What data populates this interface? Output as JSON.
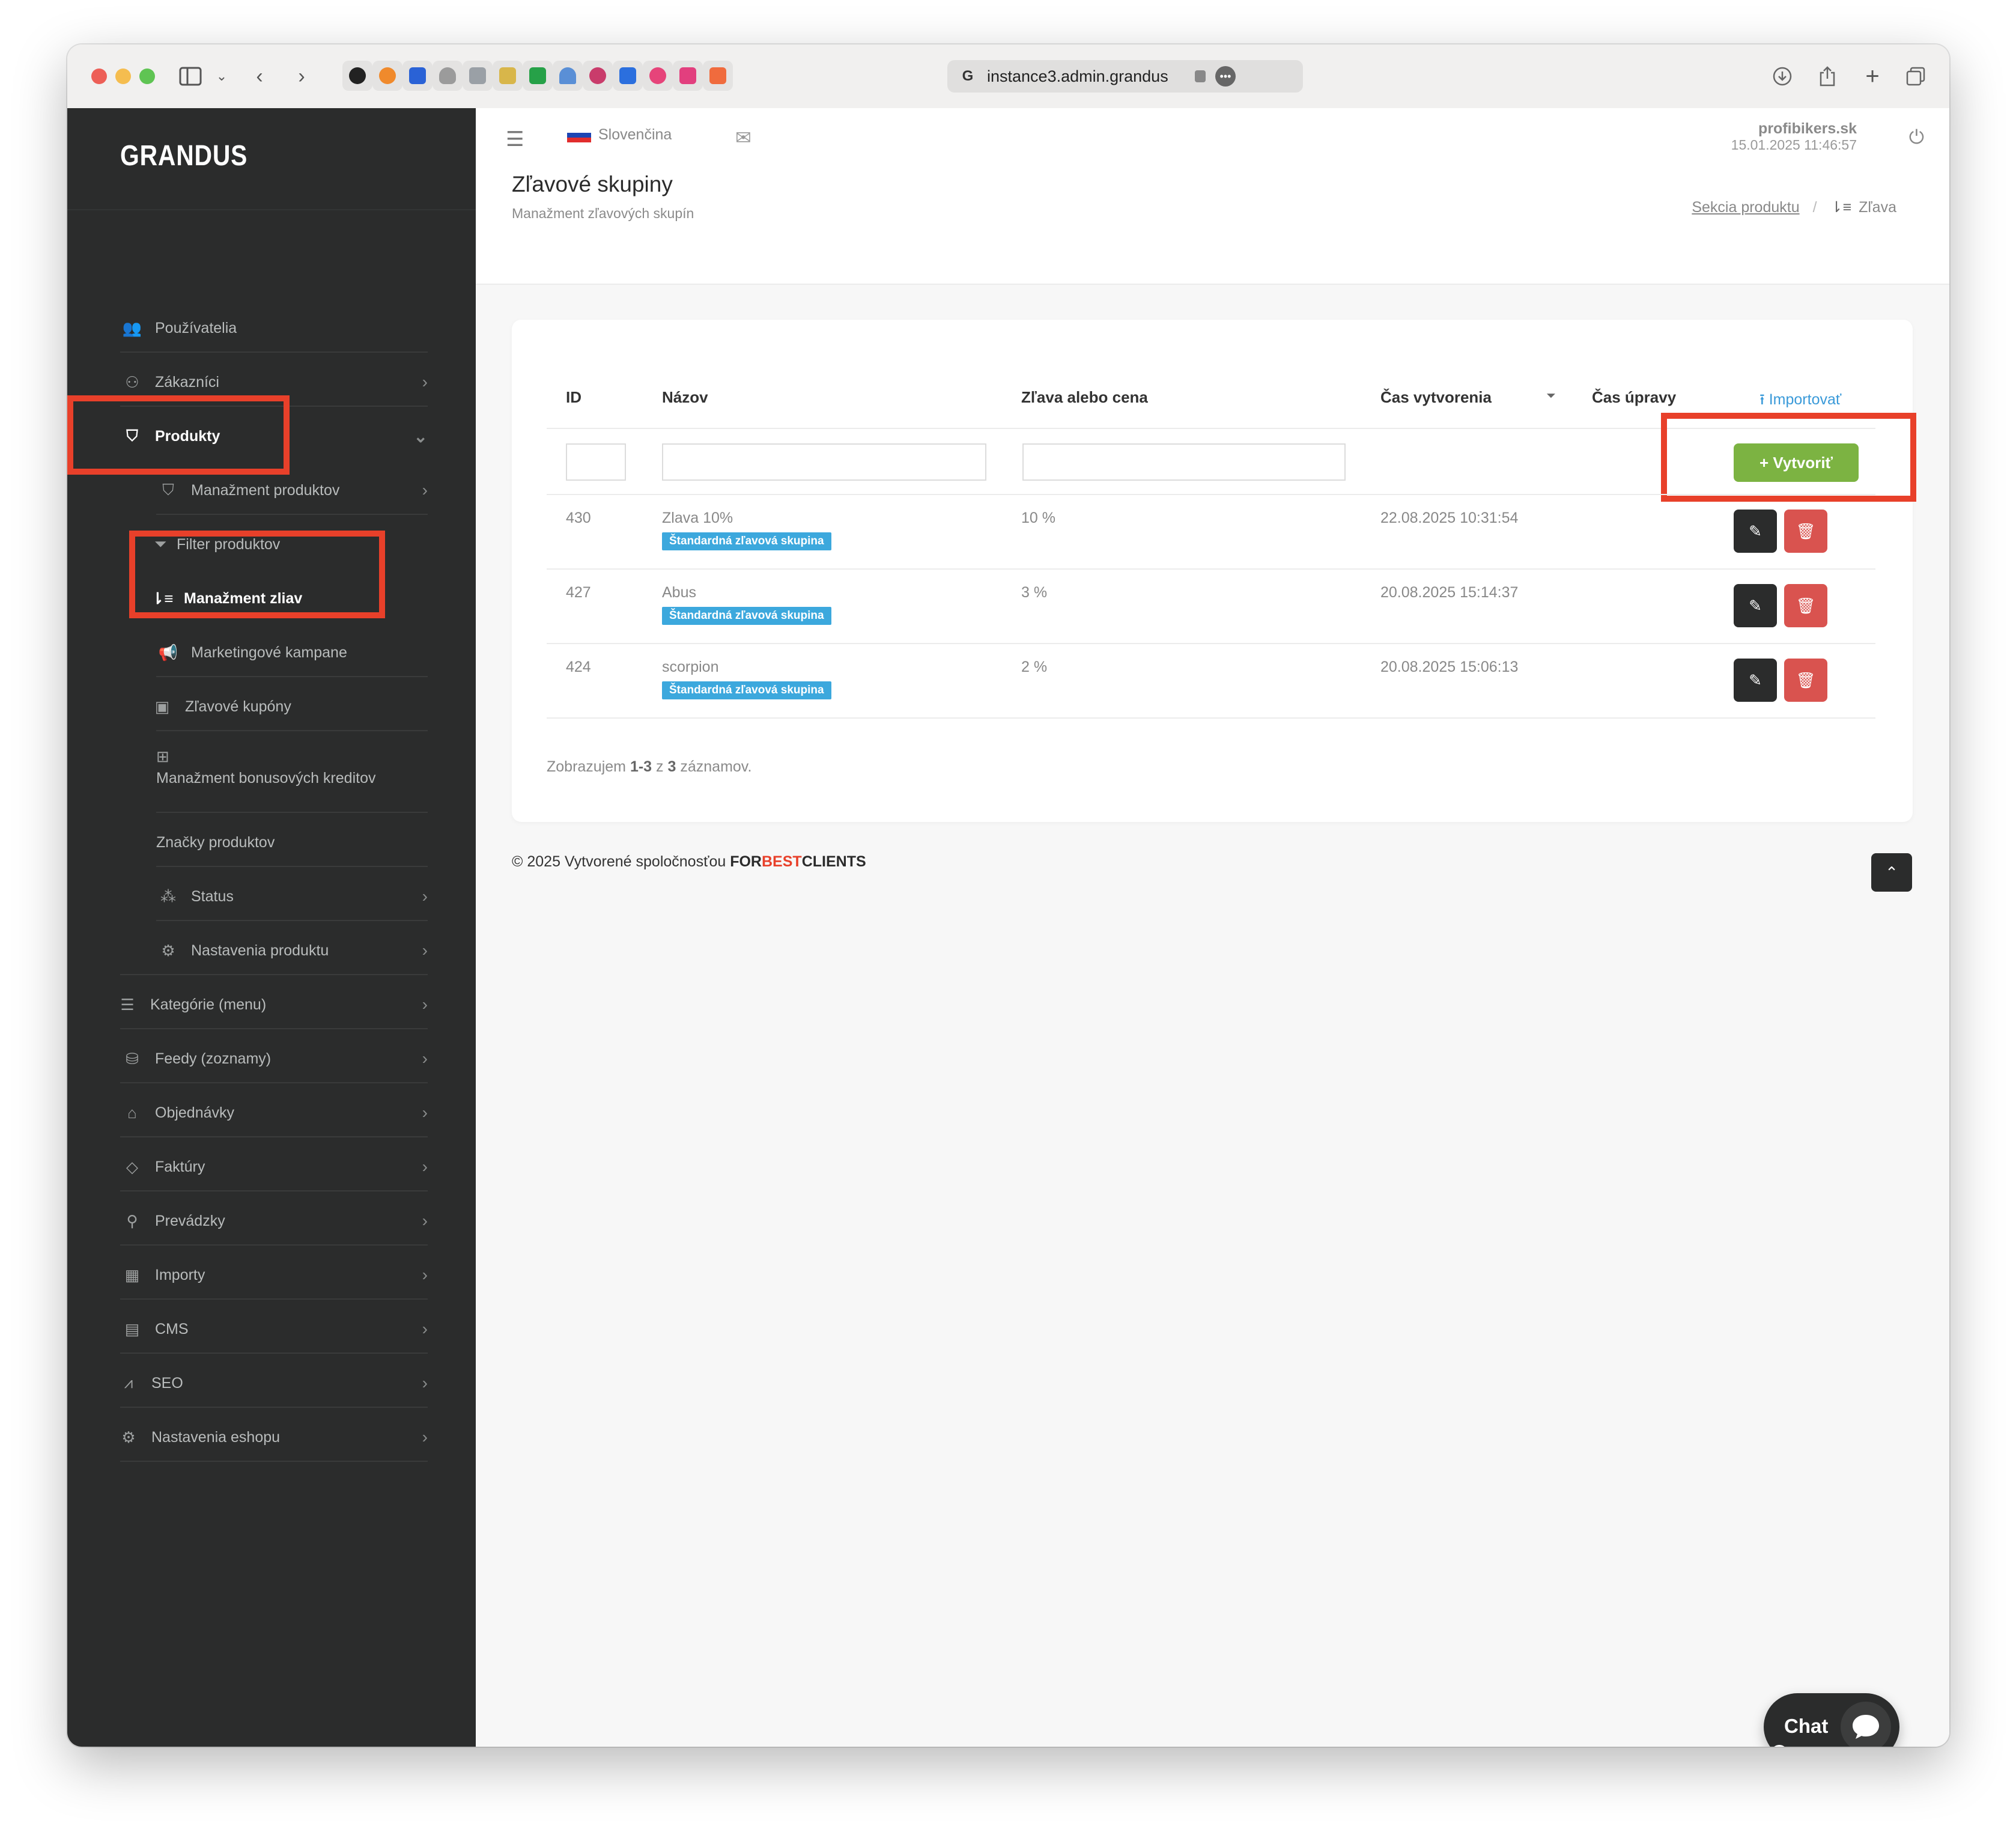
{
  "browser": {
    "url": "instance3.admin.grandus",
    "colors": {
      "close": "#ed5f57",
      "minimize": "#f5bd4f",
      "maximize": "#5fc453"
    }
  },
  "sidebar": {
    "logo": "GRANDUS",
    "items": [
      {
        "label": "Používatelia",
        "icon": "users-icon"
      },
      {
        "label": "Zákazníci",
        "icon": "user-icon"
      },
      {
        "label": "Produkty",
        "icon": "shirt-icon"
      },
      {
        "label": "Manažment produktov",
        "icon": "shirt-icon"
      },
      {
        "label": "Filter produktov",
        "icon": "filter-icon"
      },
      {
        "label": "Manažment zliav",
        "icon": "sort-amount-icon"
      },
      {
        "label": "Marketingové kampane",
        "icon": "megaphone-icon"
      },
      {
        "label": "Zľavové kupóny",
        "icon": "money-bill-icon"
      },
      {
        "label": "Manažment bonusových kreditov",
        "icon": "plus-square-icon"
      },
      {
        "label": "Značky produktov",
        "icon": ""
      },
      {
        "label": "Status",
        "icon": "spinner-icon"
      },
      {
        "label": "Nastavenia produktu",
        "icon": "cogs-icon"
      },
      {
        "label": "Kategórie (menu)",
        "icon": "list-icon"
      },
      {
        "label": "Feedy (zoznamy)",
        "icon": "database-icon"
      },
      {
        "label": "Objednávky",
        "icon": "inbox-icon"
      },
      {
        "label": "Faktúry",
        "icon": "tag-icon"
      },
      {
        "label": "Prevádzky",
        "icon": "map-marker-icon"
      },
      {
        "label": "Importy",
        "icon": "table-icon"
      },
      {
        "label": "CMS",
        "icon": "newspaper-icon"
      },
      {
        "label": "SEO",
        "icon": "chart-line-icon"
      },
      {
        "label": "Nastavenia eshopu",
        "icon": "cogs-icon"
      }
    ]
  },
  "header": {
    "language": "Slovenčina",
    "user_name": "profibikers.sk",
    "user_datetime": "15.01.2025 11:46:57",
    "page_title": "Zľavové skupiny",
    "page_subtitle": "Manažment zľavových skupín",
    "breadcrumb_link": "Sekcia produktu",
    "breadcrumb_sep": "/",
    "breadcrumb_current": "Zľava"
  },
  "table": {
    "columns": {
      "id": "ID",
      "name": "Názov",
      "discount": "Zľava alebo cena",
      "created": "Čas vytvorenia",
      "updated": "Čas úpravy"
    },
    "import_label": "Importovať",
    "create_label": "+ Vytvoriť",
    "rows": [
      {
        "id": "430",
        "name": "Zlava 10%",
        "badge": "Štandardná zľavová skupina",
        "discount": "10 %",
        "created": "22.08.2025 10:31:54"
      },
      {
        "id": "427",
        "name": "Abus",
        "badge": "Štandardná zľavová skupina",
        "discount": "3 %",
        "created": "20.08.2025 15:14:37"
      },
      {
        "id": "424",
        "name": "scorpion",
        "badge": "Štandardná zľavová skupina",
        "discount": "2 %",
        "created": "20.08.2025 15:06:13"
      }
    ],
    "summary": {
      "prefix": "Zobrazujem",
      "range": "1-3",
      "of": "z",
      "total": "3",
      "suffix": "záznamov."
    }
  },
  "footer": {
    "text": "© 2025 Vytvorené spoločnosťou",
    "brand_for": "FOR",
    "brand_best": "BEST",
    "brand_clients": "CLIENTS"
  },
  "chat": {
    "label": "Chat"
  },
  "colors": {
    "sidebar_bg": "#2b2c2c",
    "highlight": "#e8402a",
    "create_button": "#7cb342",
    "delete_button": "#d9534f",
    "badge": "#3ca8dd",
    "link": "#3a9ad9"
  }
}
